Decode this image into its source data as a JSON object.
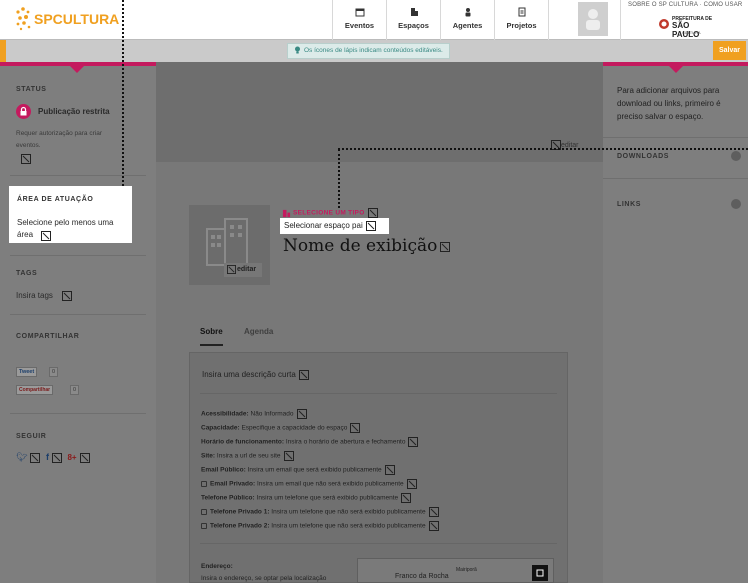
{
  "header": {
    "logo_text": "SPCULTURA",
    "nav": [
      {
        "label": "Eventos",
        "icon": "calendar-icon"
      },
      {
        "label": "Espaços",
        "icon": "building-icon"
      },
      {
        "label": "Agentes",
        "icon": "person-icon"
      },
      {
        "label": "Projetos",
        "icon": "document-icon"
      }
    ],
    "top_links": "SOBRE O SP CULTURA · COMO USAR",
    "prefeitura": "PREFEITURA DE",
    "prefeitura_city": "SÃO PAULO",
    "prefeitura_sub": "CULTURA"
  },
  "toolbar": {
    "tip": "Os ícones de lápis indicam conteúdos editáveis.",
    "save_label": "Salvar"
  },
  "left": {
    "status_title": "STATUS",
    "status_value": "Publicação restrita",
    "status_desc_1": "Requer autorização para criar",
    "status_desc_2": "eventos.",
    "area_title": "ÁREA DE ATUAÇÃO",
    "area_text_1": "Selecione pelo menos uma",
    "area_text_2": "área",
    "tags_title": "TAGS",
    "tags_text": "Insira tags",
    "share_title": "COMPARTILHAR",
    "tweet_label": "Tweet",
    "tweet_count": "0",
    "gplus_label": "Compartilhar",
    "gplus_count": "0",
    "follow_title": "SEGUIR"
  },
  "right": {
    "notice": "Para adicionar arquivos para download ou links, primeiro é preciso salvar o espaço.",
    "downloads_title": "DOWNLOADS",
    "links_title": "LINKS"
  },
  "main": {
    "cover_edit": "editar",
    "type_label": "SELECIONE UM TIPO",
    "parent_label": "Selecionar espaço pai",
    "display_name": "Nome de exibição",
    "avatar_edit": "editar",
    "tabs": [
      "Sobre",
      "Agenda"
    ],
    "short_desc": "Insira uma descrição curta",
    "fields": [
      {
        "label": "Acessibilidade:",
        "value": "Não Informado",
        "locked": false
      },
      {
        "label": "Capacidade:",
        "value": "Especifique a capacidade do espaço",
        "locked": false
      },
      {
        "label": "Horário de funcionamento:",
        "value": "Insira o horário de abertura e fechamento",
        "locked": false
      },
      {
        "label": "Site:",
        "value": "Insira a url de seu site",
        "locked": false
      },
      {
        "label": "Email Público:",
        "value": "Insira um email que será exibido publicamente",
        "locked": false
      },
      {
        "label": "Email Privado:",
        "value": "Insira um email que não será exibido publicamente",
        "locked": true
      },
      {
        "label": "Telefone Público:",
        "value": "Insira um telefone que será exibido publicamente",
        "locked": false
      },
      {
        "label": "Telefone Privado 1:",
        "value": "Insira um telefone que não será exibido publicamente",
        "locked": true
      },
      {
        "label": "Telefone Privado 2:",
        "value": "Insira um telefone que não será exibido publicamente",
        "locked": true
      }
    ],
    "address_label": "Endereço:",
    "address_text": "Insira o endereço, se optar pela localização",
    "map_city": "Franco da Rocha",
    "map_town": "Mairiporã"
  },
  "colors": {
    "accent": "#c41a5e",
    "save": "#f0a020",
    "tip_text": "#3a8a84"
  }
}
